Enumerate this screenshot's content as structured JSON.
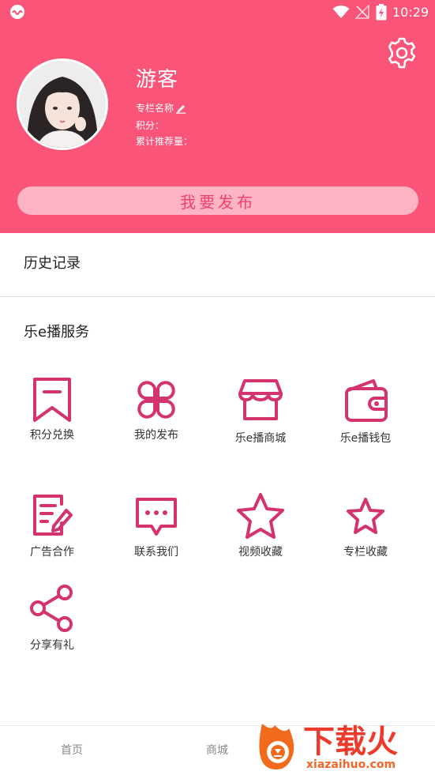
{
  "status_bar": {
    "time": "10:29"
  },
  "profile": {
    "username": "游客",
    "column_name_label": "专栏名称",
    "points_label": "积分：",
    "cumulative_recommend_label": "累计推荐量："
  },
  "publish_button": {
    "label": "我要发布"
  },
  "history": {
    "label": "历史记录"
  },
  "services": {
    "title": "乐e播服务",
    "items": [
      {
        "label": "积分兑换",
        "icon": "bookmark-icon"
      },
      {
        "label": "我的发布",
        "icon": "grid-icon"
      },
      {
        "label": "乐e播商城",
        "icon": "shop-icon"
      },
      {
        "label": "乐e播钱包",
        "icon": "wallet-icon"
      },
      {
        "label": "广告合作",
        "icon": "edit-document-icon"
      },
      {
        "label": "联系我们",
        "icon": "message-icon"
      },
      {
        "label": "视频收藏",
        "icon": "star-outline-icon"
      },
      {
        "label": "专栏收藏",
        "icon": "star-outline-icon"
      },
      {
        "label": "分享有礼",
        "icon": "share-icon"
      }
    ]
  },
  "bottom_nav": {
    "items": [
      {
        "label": "首页"
      },
      {
        "label": "商城"
      }
    ]
  },
  "watermark": {
    "brand": "下载火",
    "url": "xiazaihuo.com"
  },
  "colors": {
    "accent": "#fa5479",
    "icon_stroke": "#d4336e",
    "publish_bg": "#ffb4c4"
  }
}
